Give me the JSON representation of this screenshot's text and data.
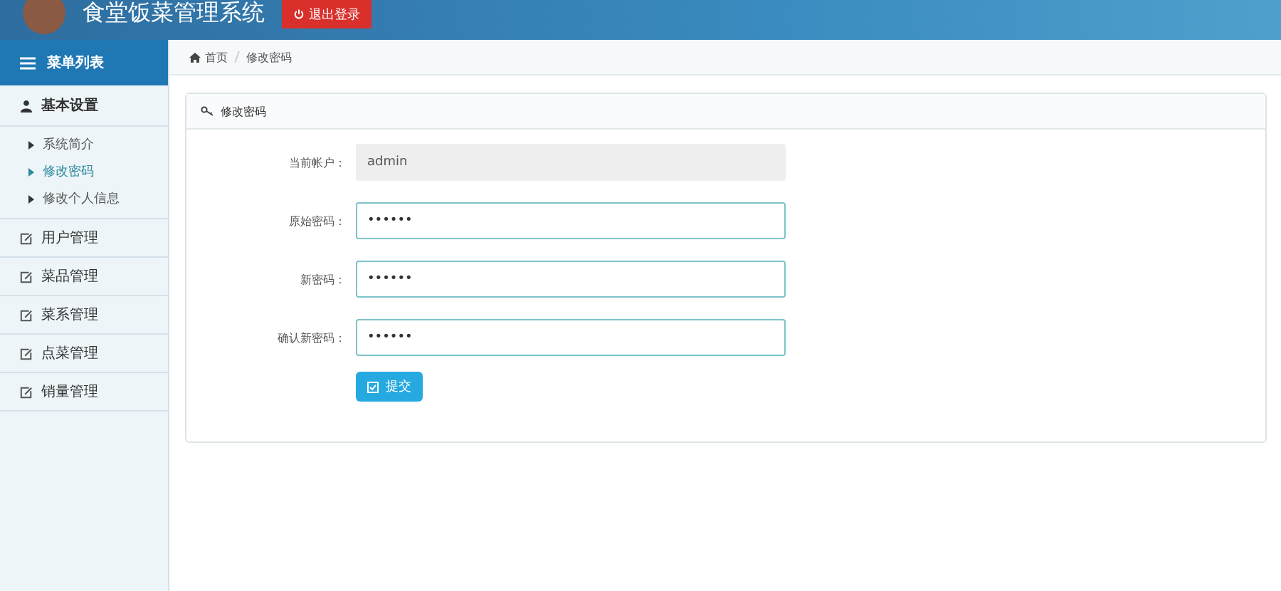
{
  "header": {
    "title": "食堂饭菜管理系统",
    "logout_button": "退出登录"
  },
  "sidebar": {
    "title": "菜单列表",
    "groups": [
      {
        "label": "基本设置",
        "kind": "user",
        "expanded": true,
        "children": [
          {
            "label": "系统简介",
            "selected": false
          },
          {
            "label": "修改密码",
            "selected": true
          },
          {
            "label": "修改个人信息",
            "selected": false
          }
        ]
      },
      {
        "label": "用户管理",
        "kind": "edit",
        "expanded": false
      },
      {
        "label": "菜品管理",
        "kind": "edit",
        "expanded": false
      },
      {
        "label": "菜系管理",
        "kind": "edit",
        "expanded": false
      },
      {
        "label": "点菜管理",
        "kind": "edit",
        "expanded": false
      },
      {
        "label": "销量管理",
        "kind": "edit",
        "expanded": false
      }
    ]
  },
  "breadcrumb": [
    "首页",
    "修改密码"
  ],
  "panel": {
    "title": "修改密码",
    "fields": [
      {
        "label": "当前帐户：",
        "value": "admin",
        "disabled": true
      },
      {
        "label": "原始密码：",
        "value": "••••••",
        "disabled": false
      },
      {
        "label": "新密码：",
        "value": "••••••",
        "disabled": false
      },
      {
        "label": "确认新密码：",
        "value": "••••••",
        "disabled": false
      }
    ],
    "submit": "提交"
  }
}
